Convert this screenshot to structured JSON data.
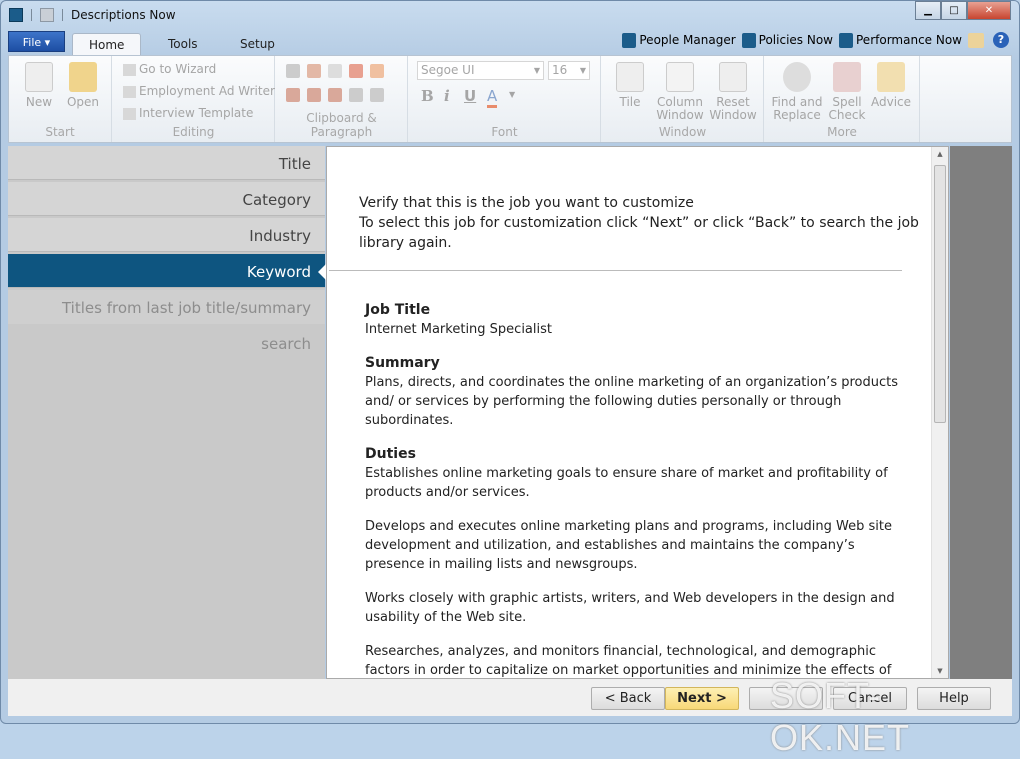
{
  "window": {
    "title": "Descriptions Now",
    "minimize": "▁",
    "maximize": "□",
    "close": "✕"
  },
  "tabs": {
    "file": "File ▾",
    "home": "Home",
    "tools": "Tools",
    "setup": "Setup"
  },
  "links": {
    "people": "People Manager",
    "policies": "Policies Now",
    "performance": "Performance Now"
  },
  "ribbon": {
    "start": {
      "label": "Start",
      "new": "New",
      "open": "Open"
    },
    "editing": {
      "label": "Editing",
      "wizard": "Go to Wizard",
      "adwriter": "Employment Ad Writer",
      "interview": "Interview Template"
    },
    "clipboard": {
      "label": "Clipboard & Paragraph"
    },
    "font": {
      "label": "Font",
      "family": "Segoe UI",
      "size": "16",
      "bold": "B",
      "italic": "i",
      "underline": "U",
      "color": "A"
    },
    "window": {
      "label": "Window",
      "tile": "Tile",
      "column": "Column Window",
      "reset": "Reset Window"
    },
    "more": {
      "label": "More",
      "find": "Find and Replace",
      "spell": "Spell Check",
      "advice": "Advice"
    }
  },
  "nav": {
    "items": [
      "Title",
      "Category",
      "Industry",
      "Keyword"
    ],
    "extra": "Titles from last job title/summary search"
  },
  "content": {
    "intro1": "Verify that this is the job you want to customize",
    "intro2": "To select this job for customization click “Next” or click “Back” to search the job library again.",
    "jobtitle_h": "Job Title",
    "jobtitle": "Internet Marketing Specialist",
    "summary_h": "Summary",
    "summary": "Plans, directs, and coordinates the online marketing of an organization’s products and/ or services by performing the following duties personally or through subordinates.",
    "duties_h": "Duties",
    "duties": [
      "Establishes online marketing goals to ensure share of market and profitability of products and/or services.",
      "Develops and executes online marketing plans and programs, including Web site development and utilization, and establishes and maintains the company’s presence in mailing lists and newsgroups.",
      "Works closely with graphic artists, writers, and Web developers in the design and usability of the Web site.",
      "Researches, analyzes, and monitors financial, technological, and demographic factors in order to capitalize on market opportunities and minimize the effects of competitive"
    ]
  },
  "footer": {
    "back": "< Back",
    "next": "Next >",
    "finish": "",
    "cancel": "Cancel",
    "help": "Help"
  },
  "watermark": "SOFT-OK.NET"
}
